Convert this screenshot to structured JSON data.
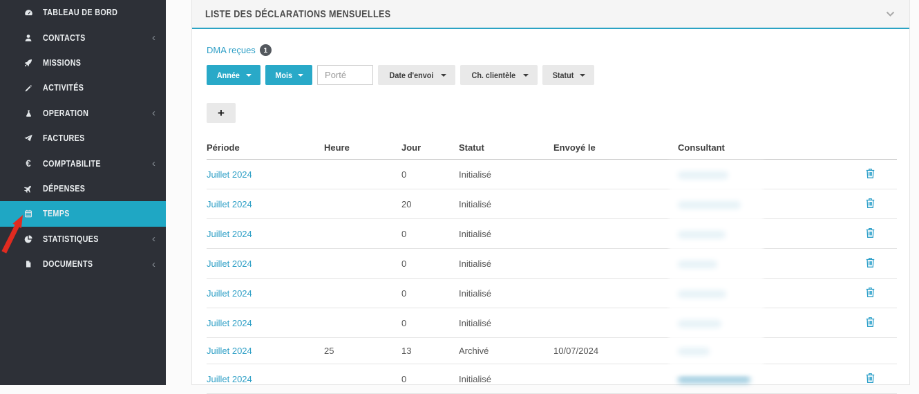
{
  "colors": {
    "accent": "#29a9c8",
    "sidebar_bg": "#2d3037",
    "sidebar_active": "#1fa7c4",
    "link": "#2e9fc6",
    "header_underline": "#2ba3c4",
    "annotation_arrow": "#e02b20",
    "badge_bg": "#53585e"
  },
  "sidebar": {
    "items": [
      {
        "label": "TABLEAU DE BORD",
        "icon": "tachometer-icon",
        "chevron": false,
        "active": false
      },
      {
        "label": "CONTACTS",
        "icon": "user-icon",
        "chevron": true,
        "active": false
      },
      {
        "label": "MISSIONS",
        "icon": "rocket-icon",
        "chevron": false,
        "active": false
      },
      {
        "label": "ACTIVITÉS",
        "icon": "pencil-icon",
        "chevron": false,
        "active": false
      },
      {
        "label": "OPERATION",
        "icon": "flask-icon",
        "chevron": true,
        "active": false
      },
      {
        "label": "FACTURES",
        "icon": "paper-plane-icon",
        "chevron": false,
        "active": false
      },
      {
        "label": "COMPTABILITE",
        "icon": "euro-icon",
        "chevron": true,
        "active": false
      },
      {
        "label": "DÉPENSES",
        "icon": "plane-icon",
        "chevron": false,
        "active": false
      },
      {
        "label": "TEMPS",
        "icon": "calendar-icon",
        "chevron": false,
        "active": true
      },
      {
        "label": "STATISTIQUES",
        "icon": "pie-chart-icon",
        "chevron": true,
        "active": false
      },
      {
        "label": "DOCUMENTS",
        "icon": "document-icon",
        "chevron": true,
        "active": false
      }
    ]
  },
  "panel": {
    "title": "LISTE DES DÉCLARATIONS MENSUELLES",
    "dma": {
      "label": "DMA reçues",
      "badge": "1"
    },
    "filters": [
      {
        "kind": "button",
        "variant": "primary",
        "label": "Année",
        "caret": true,
        "name": "annee-filter"
      },
      {
        "kind": "button",
        "variant": "primary",
        "label": "Mois",
        "caret": true,
        "name": "mois-filter"
      },
      {
        "kind": "input",
        "placeholder": "Porté",
        "value": "",
        "name": "porte-input"
      },
      {
        "kind": "button",
        "variant": "light",
        "label": "Date d'envoi",
        "caret": true,
        "name": "date-envoi-filter"
      },
      {
        "kind": "button",
        "variant": "light",
        "label": "Ch. clientèle",
        "caret": true,
        "name": "ch-clientele-filter"
      },
      {
        "kind": "button",
        "variant": "light",
        "label": "Statut",
        "caret": true,
        "name": "statut-filter"
      }
    ],
    "add_button_label": "+",
    "table": {
      "columns": [
        "Période",
        "Heure",
        "Jour",
        "Statut",
        "Envoyé le",
        "Consultant",
        ""
      ],
      "rows": [
        {
          "periode": "Juillet 2024",
          "heure": "",
          "jour": "0",
          "statut": "Initialisé",
          "envoye_le": "",
          "consultant_redacted_width": 73,
          "has_delete_icon": true
        },
        {
          "periode": "Juillet 2024",
          "heure": "",
          "jour": "20",
          "statut": "Initialisé",
          "envoye_le": "",
          "consultant_redacted_width": 91,
          "has_delete_icon": true
        },
        {
          "periode": "Juillet 2024",
          "heure": "",
          "jour": "0",
          "statut": "Initialisé",
          "envoye_le": "",
          "consultant_redacted_width": 69,
          "has_delete_icon": true
        },
        {
          "periode": "Juillet 2024",
          "heure": "",
          "jour": "0",
          "statut": "Initialisé",
          "envoye_le": "",
          "consultant_redacted_width": 57,
          "has_delete_icon": true
        },
        {
          "periode": "Juillet 2024",
          "heure": "",
          "jour": "0",
          "statut": "Initialisé",
          "envoye_le": "",
          "consultant_redacted_width": 70,
          "has_delete_icon": true
        },
        {
          "periode": "Juillet 2024",
          "heure": "",
          "jour": "0",
          "statut": "Initialisé",
          "envoye_le": "",
          "consultant_redacted_width": 63,
          "has_delete_icon": true
        },
        {
          "periode": "Juillet 2024",
          "heure": "25",
          "jour": "13",
          "statut": "Archivé",
          "envoye_le": "10/07/2024",
          "consultant_redacted_width": 46,
          "has_delete_icon": false
        },
        {
          "periode": "Juillet 2024",
          "heure": "",
          "jour": "0",
          "statut": "Initialisé",
          "envoye_le": "",
          "consultant_redacted_width": 105,
          "has_delete_icon": true
        }
      ]
    }
  }
}
